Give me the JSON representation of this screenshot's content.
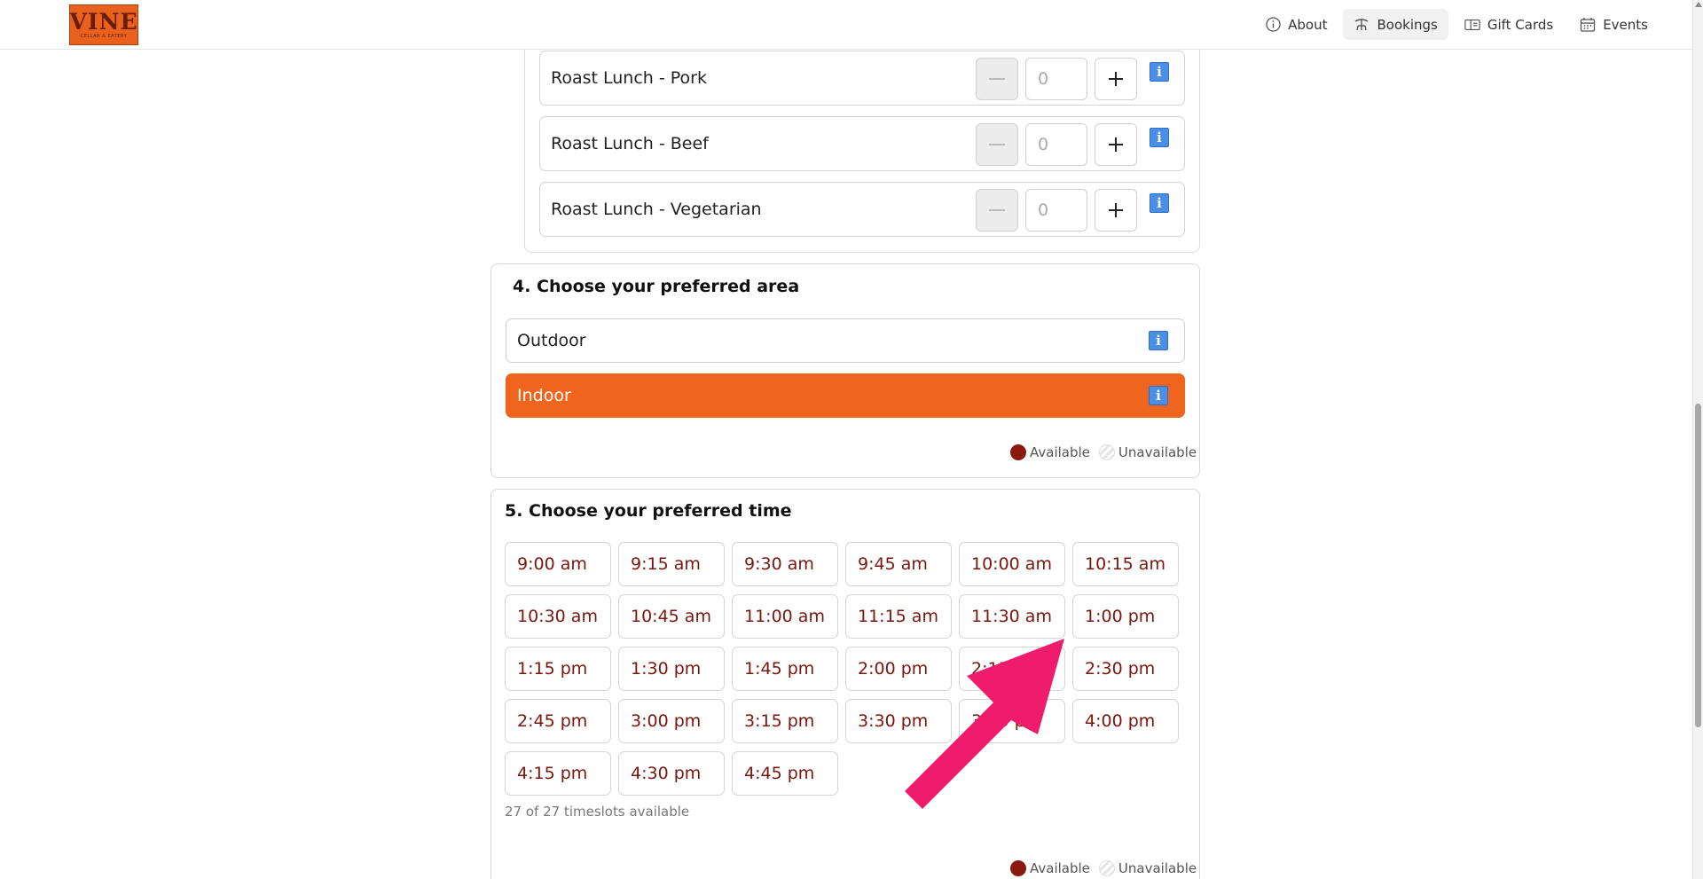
{
  "header": {
    "logo_text": "VINE",
    "logo_subtext": "CELLAR & EATERY",
    "nav": [
      {
        "label": "About",
        "icon": "info-circle-icon"
      },
      {
        "label": "Bookings",
        "icon": "bookings-icon",
        "active": true
      },
      {
        "label": "Gift Cards",
        "icon": "gift-card-icon"
      },
      {
        "label": "Events",
        "icon": "calendar-icon"
      }
    ]
  },
  "menu_items": [
    {
      "name": "Roast Lunch - Pork",
      "qty": "0"
    },
    {
      "name": "Roast Lunch - Beef",
      "qty": "0"
    },
    {
      "name": "Roast Lunch - Vegetarian",
      "qty": "0"
    }
  ],
  "area": {
    "title": "4. Choose your preferred area",
    "options": [
      {
        "label": "Outdoor",
        "selected": false
      },
      {
        "label": "Indoor",
        "selected": true
      }
    ],
    "legend_available": "Available",
    "legend_unavailable": "Unavailable"
  },
  "time": {
    "title": "5. Choose your preferred time",
    "slots": [
      "9:00 am",
      "9:15 am",
      "9:30 am",
      "9:45 am",
      "10:00 am",
      "10:15 am",
      "10:30 am",
      "10:45 am",
      "11:00 am",
      "11:15 am",
      "11:30 am",
      "1:00 pm",
      "1:15 pm",
      "1:30 pm",
      "1:45 pm",
      "2:00 pm",
      "2:15 pm",
      "2:30 pm",
      "2:45 pm",
      "3:00 pm",
      "3:15 pm",
      "3:30 pm",
      "3:45 pm",
      "4:00 pm",
      "4:15 pm",
      "4:30 pm",
      "4:45 pm"
    ],
    "count_text": "27 of 27 timeslots available",
    "legend_available": "Available",
    "legend_unavailable": "Unavailable"
  },
  "colors": {
    "accent": "#f0651e",
    "slot_text": "#7a160e",
    "available_dot": "#8a1a10",
    "info_icon": "#4a8ee6",
    "annotation_arrow": "#ee1c6a"
  }
}
